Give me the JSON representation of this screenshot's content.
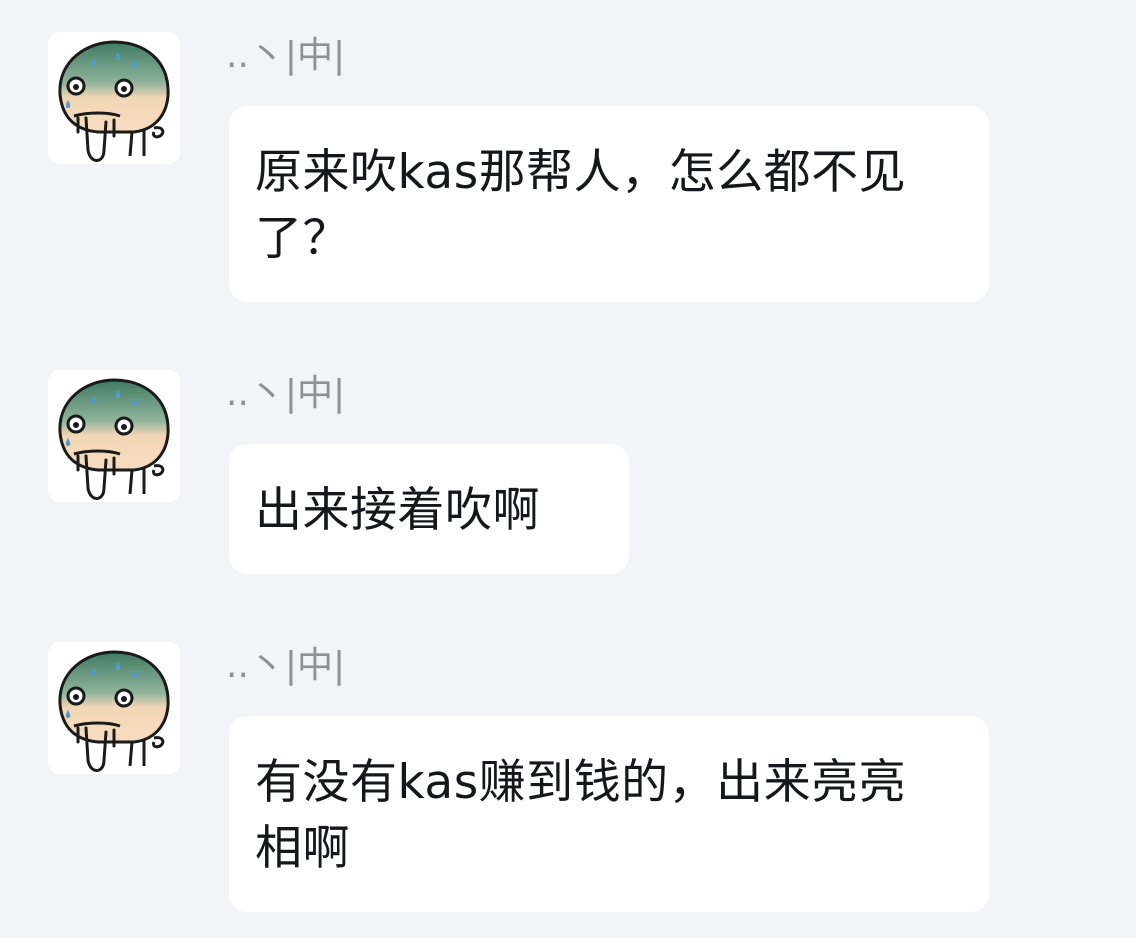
{
  "messages": [
    {
      "sender": "..丶|中|",
      "avatar_icon": "sweating-face-avatar-icon",
      "text": "原来吹kas那帮人，怎么都不见了？"
    },
    {
      "sender": "..丶|中|",
      "avatar_icon": "sweating-face-avatar-icon",
      "text": "出来接着吹啊"
    },
    {
      "sender": "..丶|中|",
      "avatar_icon": "sweating-face-avatar-icon",
      "text": "有没有kas赚到钱的，出来亮亮相啊"
    }
  ]
}
